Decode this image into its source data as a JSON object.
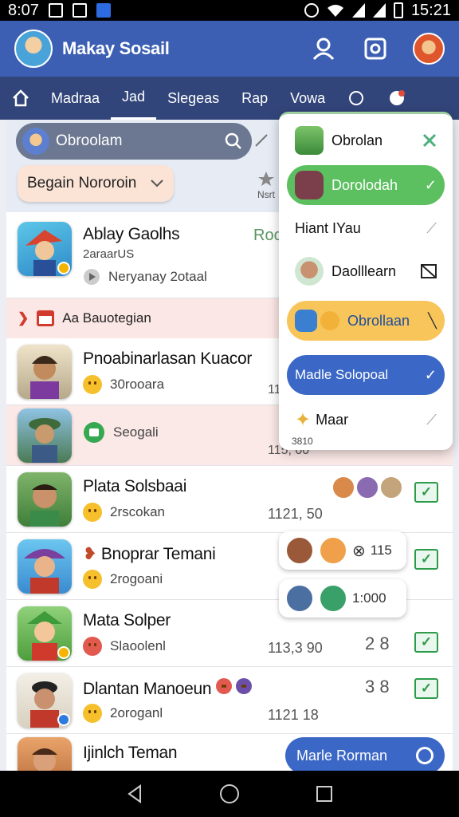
{
  "status_bar": {
    "time_left": "8:07",
    "time_right": "15:21"
  },
  "app": {
    "title": "Makay Sosail"
  },
  "tabs": [
    {
      "label": "Madraa"
    },
    {
      "label": "Jad"
    },
    {
      "label": "Slegeas"
    },
    {
      "label": "Rap"
    },
    {
      "label": "Vowa"
    }
  ],
  "search": {
    "placeholder": "Obroolam"
  },
  "filter": {
    "label": "Begain Nororoin"
  },
  "star_caption": "Nsrt",
  "section_header": {
    "label": "Aa Bauotegian"
  },
  "chats": [
    {
      "name": "Ablay Gaolhs",
      "line1": "2araarUS",
      "line2": "Neryanay 2otaal",
      "tag": "Roc"
    },
    {
      "name": "Pnoabinarlasan Kuacor",
      "line1": "30rooara",
      "time": "11"
    },
    {
      "name": "",
      "line1": "Seogali",
      "time": "115, 00"
    },
    {
      "name": "Plata Solsbaai",
      "line1": "2rscokan",
      "time": "1121, 50"
    },
    {
      "name": "Bnoprar Temani",
      "line1": "2rogoani"
    },
    {
      "name": "Mata Solper",
      "line1": "Slaoolenl",
      "time": "113,3 90",
      "count": "2 8"
    },
    {
      "name": "Dlantan Manoeun",
      "line1": "2oroganl",
      "time": "1121 18",
      "count": "3 8"
    },
    {
      "name": "Ijinlch Teman",
      "line1": ""
    }
  ],
  "popup": {
    "title": "Obrolan",
    "items": [
      {
        "label": "Dorolodah"
      },
      {
        "label": "Hiant IYau"
      },
      {
        "label": "Daolllearn"
      },
      {
        "label": "Obrollaan"
      },
      {
        "label": "Madle Solopoal"
      },
      {
        "label": "Maar"
      }
    ],
    "footnote": "3810"
  },
  "bubbles": {
    "first_count": "115",
    "second_time": "1:000"
  },
  "fab": {
    "label": "Marle Rorman"
  },
  "colors": {
    "appbar": "#3c5fb3",
    "tabs": "#32457a",
    "accent_green": "#5cc060",
    "accent_blue": "#3b67c6"
  }
}
